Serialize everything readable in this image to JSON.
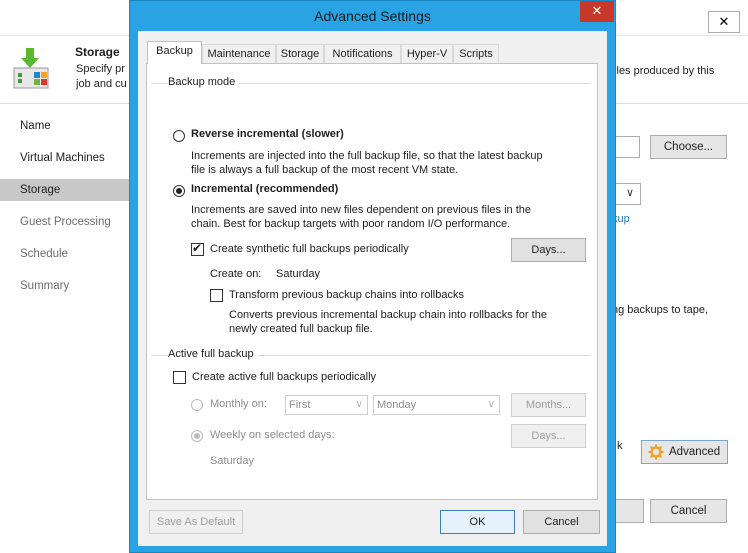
{
  "background_window": {
    "close_glyph": "✕",
    "header": {
      "title": "Storage",
      "description_line1": "Specify pr",
      "description_line2": "job and cu",
      "description_right1": "files produced by this",
      "description_right2": ""
    },
    "nav": [
      {
        "label": "Name",
        "state": "normal"
      },
      {
        "label": "Virtual Machines",
        "state": "normal"
      },
      {
        "label": "Storage",
        "state": "active"
      },
      {
        "label": "Guest Processing",
        "state": "dim"
      },
      {
        "label": "Schedule",
        "state": "dim"
      },
      {
        "label": "Summary",
        "state": "dim"
      }
    ],
    "choose_label": "Choose...",
    "combo_arrow": "∨",
    "link_fragment": "kup",
    "tape_fragment": "ng backups to tape,",
    "k_fragment": "k",
    "advanced_label": "Advanced",
    "cancel_label": "Cancel"
  },
  "dialog": {
    "title": "Advanced Settings",
    "close_glyph": "✕",
    "tabs": [
      "Backup",
      "Maintenance",
      "Storage",
      "Notifications",
      "Hyper-V",
      "Scripts"
    ],
    "active_tab": "Backup",
    "backup_mode": {
      "group_label": "Backup mode",
      "reverse": {
        "label": "Reverse incremental (slower)",
        "desc1": "Increments are injected into the full backup file, so that the latest backup",
        "desc2": "file is always a full backup of the most recent VM state.",
        "selected": false
      },
      "incremental": {
        "label": "Incremental (recommended)",
        "desc1": "Increments are saved into new files dependent on previous files in the",
        "desc2": "chain. Best for backup targets with poor random I/O performance.",
        "selected": true
      },
      "synthetic": {
        "label": "Create synthetic full backups periodically",
        "checked": true,
        "days_button": "Days...",
        "create_on_label": "Create on:",
        "create_on_value": "Saturday"
      },
      "transform": {
        "label": "Transform previous backup chains into rollbacks",
        "checked": false,
        "desc1": "Converts previous incremental backup chain into rollbacks for the",
        "desc2": "newly created full backup file."
      }
    },
    "active_full": {
      "group_label": "Active full backup",
      "create_label": "Create active full backups periodically",
      "checked": false,
      "monthly_label": "Monthly on:",
      "monthly_selected": false,
      "monthly_week": "First",
      "monthly_day": "Monday",
      "months_button": "Months...",
      "weekly_label": "Weekly on selected days:",
      "weekly_selected": true,
      "days_button": "Days...",
      "weekly_value": "Saturday"
    },
    "footer": {
      "save_default": "Save As Default",
      "ok": "OK",
      "cancel": "Cancel"
    }
  },
  "colors": {
    "dialog_border": "#29a3e3",
    "close_red": "#c7382b",
    "link_blue": "#1f7ab8",
    "nav_active": "#c8c8c8"
  }
}
